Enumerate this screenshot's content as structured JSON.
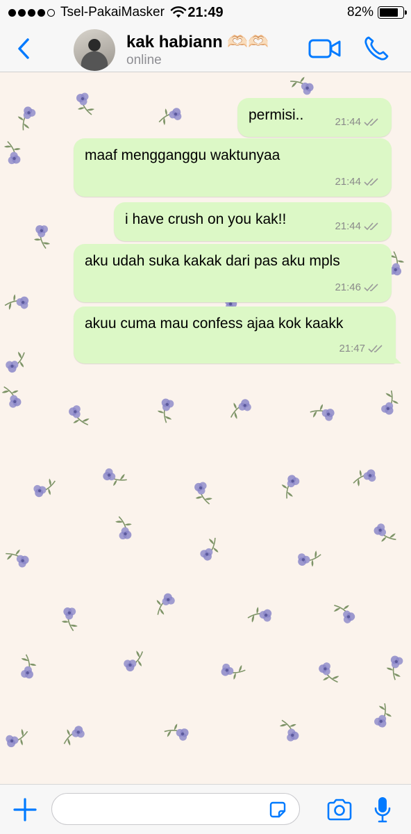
{
  "status_bar": {
    "carrier": "Tsel-PakaiMasker",
    "time": "21:49",
    "battery": "82%",
    "battery_level": 0.82
  },
  "header": {
    "contact_name": "kak habiann 🫶🏻🫶🏻",
    "contact_status": "online"
  },
  "messages": [
    {
      "text": "permisi..",
      "time": "21:44",
      "status_icon": "double-check-icon"
    },
    {
      "text": "maaf mengganggu waktunyaa",
      "time": "21:44",
      "status_icon": "double-check-icon"
    },
    {
      "text": "i have crush on you kak!!",
      "time": "21:44",
      "status_icon": "double-check-icon"
    },
    {
      "text": "aku udah suka kakak dari pas aku mpls",
      "time": "21:46",
      "status_icon": "double-check-icon"
    },
    {
      "text": "akuu cuma mau confess ajaa kok kaakk",
      "time": "21:47",
      "status_icon": "double-check-icon"
    }
  ],
  "input_bar": {
    "placeholder": ""
  },
  "colors": {
    "accent": "#007aff",
    "bubble_out": "#dcf8c6",
    "wallpaper": "#fbf3ec",
    "flower_petal": "#8b87c9",
    "flower_leaf": "#7e9468"
  }
}
